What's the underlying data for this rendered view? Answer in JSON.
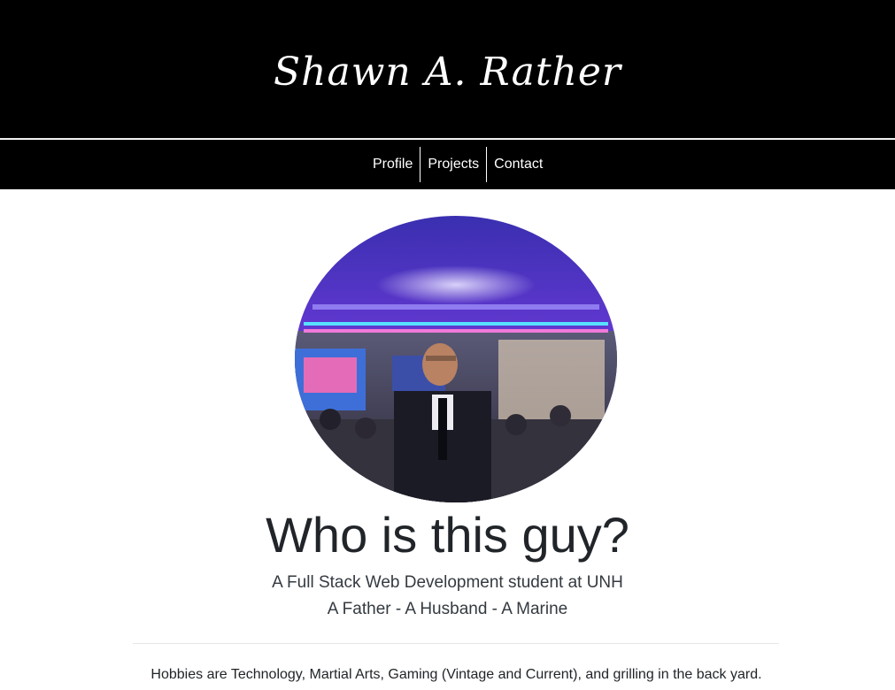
{
  "header": {
    "site_title": "Shawn A. Rather"
  },
  "nav": {
    "items": [
      {
        "label": "Profile"
      },
      {
        "label": "Projects"
      },
      {
        "label": "Contact"
      }
    ]
  },
  "profile": {
    "photo_icon": "profile-photo",
    "headline": "Who is this guy?",
    "lead_line1": "A Full Stack Web Development student at UNH",
    "lead_line2": "A Father - A Husband - A Marine",
    "hobbies": "Hobbies are Technology, Martial Arts, Gaming (Vintage and Current), and grilling in the back yard."
  },
  "colors": {
    "header_bg": "#000000",
    "nav_text": "#ffffff",
    "body_text": "#212529",
    "stage_purple": "#6a2fd1"
  }
}
